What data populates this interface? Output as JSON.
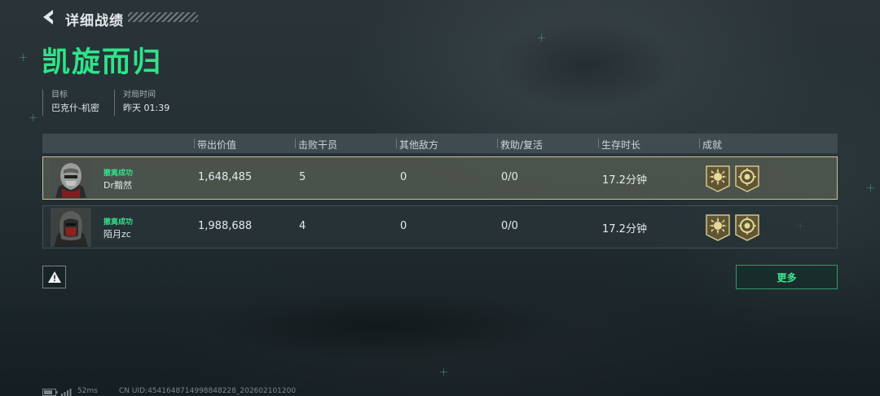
{
  "header": {
    "back_icon": "chevron-left-icon",
    "subtitle": "详细战绩",
    "result_title": "凯旋而归",
    "info": [
      {
        "label": "目标",
        "value": "巴克什-机密"
      },
      {
        "label": "对局时间",
        "value": "昨天 01:39"
      }
    ]
  },
  "table": {
    "columns": [
      "带出价值",
      "击败干员",
      "其他敌方",
      "救助/复活",
      "生存时长",
      "成就"
    ],
    "rows": [
      {
        "status": "撤离成功",
        "player": "Dr黯然",
        "value": "1,648,485",
        "kills": "5",
        "other_enemies": "0",
        "assists": "0/0",
        "survival": "17.2分钟",
        "badges": [
          "sun-badge-icon",
          "crest-badge-icon"
        ],
        "selected": true
      },
      {
        "status": "撤离成功",
        "player": "陌月zc",
        "value": "1,988,688",
        "kills": "4",
        "other_enemies": "0",
        "assists": "0/0",
        "survival": "17.2分钟",
        "badges": [
          "sun-badge-icon",
          "crest-badge-icon"
        ],
        "selected": false
      }
    ]
  },
  "actions": {
    "report_icon": "warning-icon",
    "more_label": "更多"
  },
  "footer": {
    "ping": "52ms",
    "uid": "CN UID:4541648714998848228_202602101200"
  },
  "colors": {
    "accent_green": "#2ee58a",
    "selected_border": "#e1d7aa",
    "badge_gold": "#b9a56a"
  }
}
